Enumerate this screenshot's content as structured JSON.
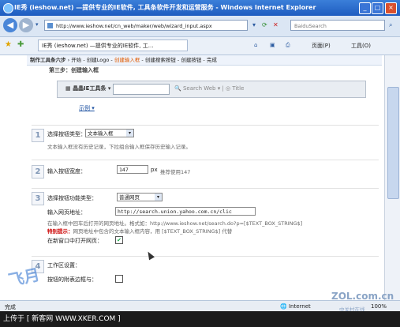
{
  "window": {
    "title": "IE秀 (ieshow.net) —提供专业的IE软件, 工具条软件开发和运营服务 - Windows Internet Explorer"
  },
  "addressbar": {
    "url": "http://www.ieshow.net/cn_web/maker/web/wizard_input.aspx",
    "search_placeholder": "BaiduSearch"
  },
  "tabs": [
    {
      "label": "IE秀 (ieshow.net) —提供专业的IE软件, 工..."
    }
  ],
  "toolbar": {
    "home_label": "",
    "page_label": "页面(P)",
    "tools_label": "工具(O)"
  },
  "steps": {
    "heading": "制作工具条六步",
    "items": [
      "开始",
      "创建Logo",
      "创建输入框",
      "创建搜索按钮",
      "创建按钮",
      "完成"
    ],
    "current_index": 2
  },
  "step_title": "第三步：创建输入框",
  "preview": {
    "toolbar_name": "晶晶IE工具条",
    "search_web": "Search Web",
    "title": "Title"
  },
  "example_link": "示例",
  "section1": {
    "number": "1",
    "label": "选择按钮类型：",
    "select_value": "文本输入框",
    "hint": "文本输入框没有历史记录，下拉组合输入框保存历史输入记录。"
  },
  "section2": {
    "number": "2",
    "label": "输入按钮宽度：",
    "value": "147",
    "unit": "px",
    "hint": "推荐使用147"
  },
  "section3": {
    "number": "3",
    "label": "选择按钮功能类型：",
    "select_value": "普通网页",
    "url_label": "输入网页地址：",
    "url_value": "http://search.union.yahoo.com.cn/clic",
    "hint1": "在输入框中回车后打开的网页地址。格式如：http://www.ieshow.net/search.do?p=[$TEXT_BOX_STRING$]",
    "hint2_label": "特别提示：",
    "hint2": "网页地址中包含的文本输入框内容，用 [$TEXT_BOX_STRING$] 代替",
    "newwindow_label": "在新窗口中打开网页：",
    "newwindow_checked": true
  },
  "section4": {
    "number": "4",
    "label": "工作区设置：",
    "option_label": "按钮的附表边框与：",
    "option_checked": false
  },
  "statusbar": {
    "left": "完成",
    "zone": "Internet",
    "zoom": "100%"
  },
  "bottom_banner": "上传于 [ 新客网 WWW.XKER.COM ]",
  "watermarks": {
    "left": "飞月",
    "right": "ZOL.com.cn",
    "right_sub": "中关村在线"
  }
}
